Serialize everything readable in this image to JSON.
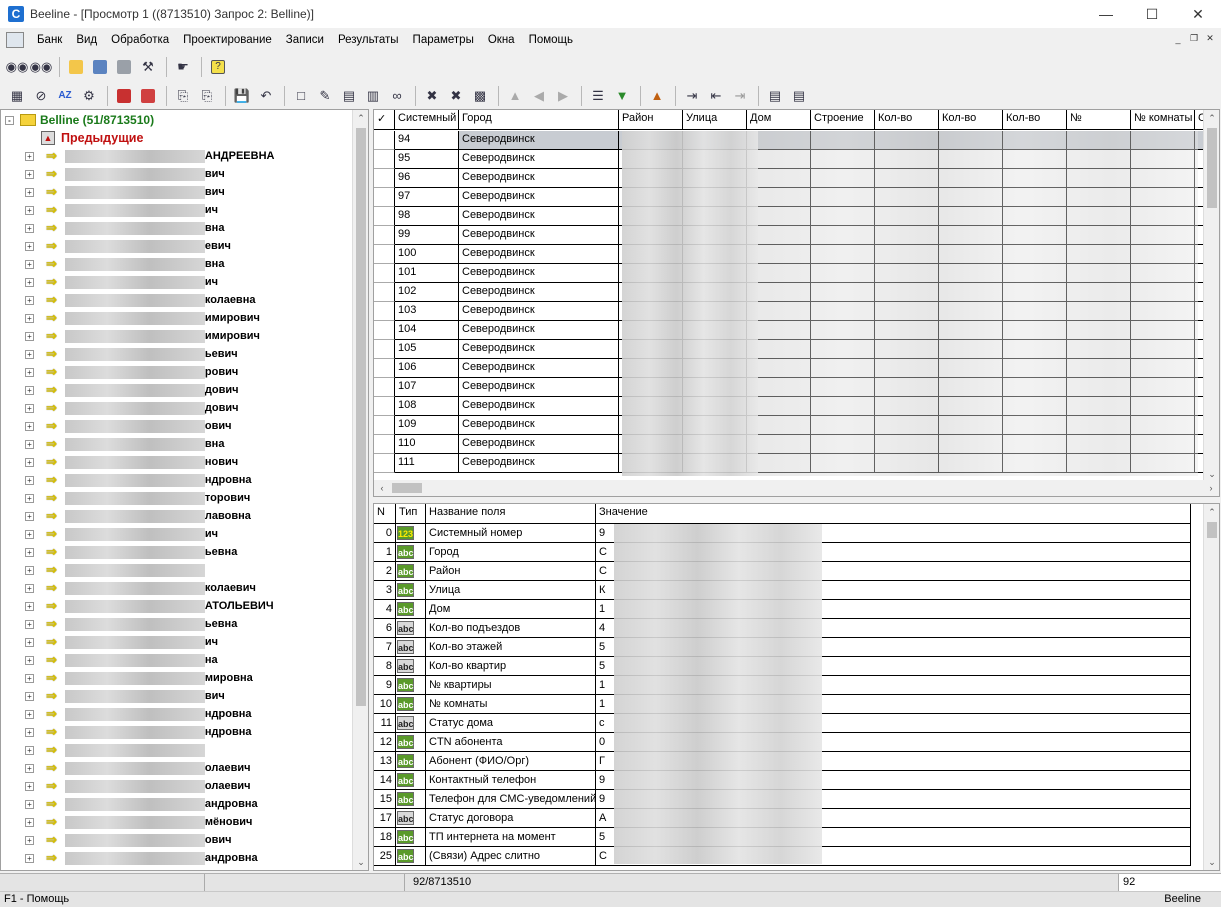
{
  "window": {
    "title": "Beeline - [Просмотр 1 ((8713510) Запрос 2: Belline)]",
    "app_icon": "C"
  },
  "menu": [
    "Банк",
    "Вид",
    "Обработка",
    "Проектирование",
    "Записи",
    "Результаты",
    "Параметры",
    "Окна",
    "Помощь"
  ],
  "tree": {
    "root": "Belline (51/8713510)",
    "previous": "Предыдущие",
    "nodes": [
      "АНДРЕЕВНА",
      "вич",
      "вич",
      "ич",
      "вна",
      "евич",
      "вна",
      "ич",
      "колаевна",
      "имирович",
      "имирович",
      "ьевич",
      "рович",
      "дович",
      "дович",
      "ович",
      "вна",
      "нович",
      "ндровна",
      "торович",
      "лавовна",
      "ич",
      "ьевна",
      "",
      "колаевич",
      "АТОЛЬЕВИЧ",
      "ьевна",
      "ич",
      "на",
      "мировна",
      "вич",
      "ндровна",
      "ндровна",
      "",
      "олаевич",
      "олаевич",
      "андровна",
      "мёнович",
      "ович",
      "андровна"
    ]
  },
  "top_grid": {
    "columns": [
      "Системный",
      "Город",
      "Район",
      "Улица",
      "Дом",
      "Строение",
      "Кол-во",
      "Кол-во",
      "Кол-во",
      "№",
      "№ комнаты",
      "С"
    ],
    "rows": [
      {
        "id": "94",
        "city": "Северодвинск"
      },
      {
        "id": "95",
        "city": "Северодвинск"
      },
      {
        "id": "96",
        "city": "Северодвинск"
      },
      {
        "id": "97",
        "city": "Северодвинск"
      },
      {
        "id": "98",
        "city": "Северодвинск"
      },
      {
        "id": "99",
        "city": "Северодвинск"
      },
      {
        "id": "100",
        "city": "Северодвинск"
      },
      {
        "id": "101",
        "city": "Северодвинск"
      },
      {
        "id": "102",
        "city": "Северодвинск"
      },
      {
        "id": "103",
        "city": "Северодвинск"
      },
      {
        "id": "104",
        "city": "Северодвинск"
      },
      {
        "id": "105",
        "city": "Северодвинск"
      },
      {
        "id": "106",
        "city": "Северодвинск"
      },
      {
        "id": "107",
        "city": "Северодвинск"
      },
      {
        "id": "108",
        "city": "Северодвинск"
      },
      {
        "id": "109",
        "city": "Северодвинск"
      },
      {
        "id": "110",
        "city": "Северодвинск"
      },
      {
        "id": "111",
        "city": "Северодвинск"
      }
    ]
  },
  "fields_grid": {
    "columns": [
      "N",
      "Тип",
      "Название поля",
      "Значение"
    ],
    "rows": [
      {
        "n": "0",
        "type": "123",
        "name": "Системный номер",
        "value": "9"
      },
      {
        "n": "1",
        "type": "abc",
        "name": "Город",
        "value": "С"
      },
      {
        "n": "2",
        "type": "abc",
        "name": "Район",
        "value": "С"
      },
      {
        "n": "3",
        "type": "abc",
        "name": "Улица",
        "value": "К"
      },
      {
        "n": "4",
        "type": "abc",
        "name": "Дом",
        "value": "1"
      },
      {
        "n": "6",
        "type": "abc",
        "name": "Кол-во подъездов",
        "value": "4"
      },
      {
        "n": "7",
        "type": "abc",
        "name": "Кол-во этажей",
        "value": "5"
      },
      {
        "n": "8",
        "type": "abc",
        "name": "Кол-во квартир",
        "value": "5"
      },
      {
        "n": "9",
        "type": "abc",
        "name": "№ квартиры",
        "value": "1"
      },
      {
        "n": "10",
        "type": "abc",
        "name": "№ комнаты",
        "value": "1"
      },
      {
        "n": "11",
        "type": "abc",
        "name": "Статус дома",
        "value": "с"
      },
      {
        "n": "12",
        "type": "abc",
        "name": "CTN абонента",
        "value": "0"
      },
      {
        "n": "13",
        "type": "abc",
        "name": "Абонент (ФИО/Орг)",
        "value": "Г"
      },
      {
        "n": "14",
        "type": "abc",
        "name": "Контактный телефон",
        "value": "9"
      },
      {
        "n": "15",
        "type": "abc",
        "name": "Телефон для СМС-уведомлений",
        "value": "9"
      },
      {
        "n": "17",
        "type": "abc",
        "name": "Статус договора",
        "value": "А"
      },
      {
        "n": "18",
        "type": "abc",
        "name": "ТП интернета на момент",
        "value": "5"
      },
      {
        "n": "25",
        "type": "abc",
        "name": "(Связи) Адрес слитно",
        "value": "С"
      }
    ]
  },
  "status": {
    "position": "92/8713510",
    "current": "92",
    "help": "F1 - Помощь",
    "app": "Beeline"
  }
}
